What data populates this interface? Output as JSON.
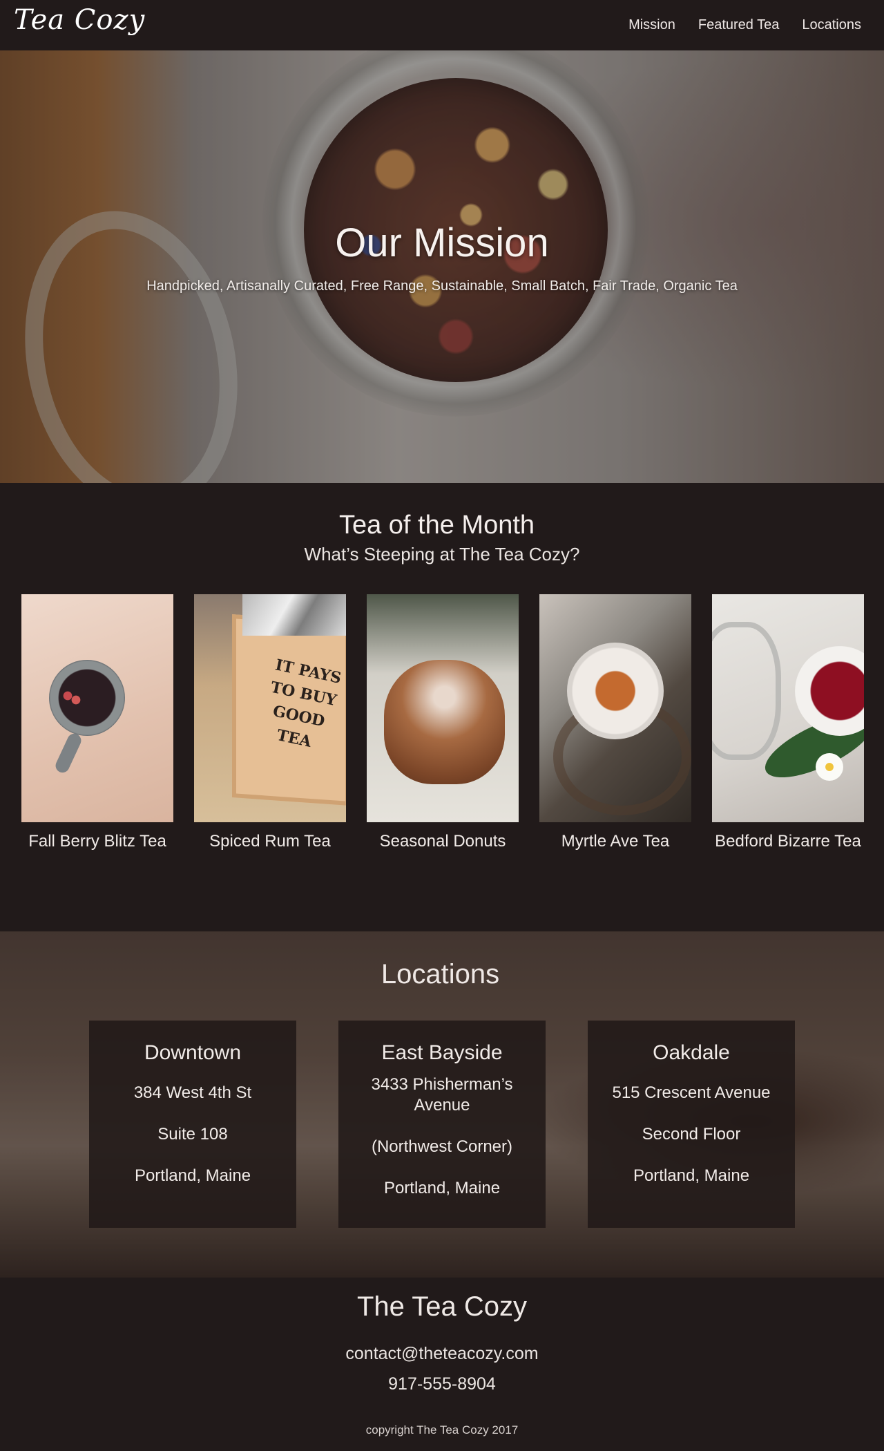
{
  "header": {
    "logo": "Tea Cozy",
    "nav": [
      "Mission",
      "Featured Tea",
      "Locations"
    ]
  },
  "hero": {
    "title": "Our Mission",
    "subtitle": "Handpicked, Artisanally Curated, Free Range, Sustainable, Small Batch, Fair Trade, Organic Tea"
  },
  "tea_of_month": {
    "title": "Tea of the Month",
    "subtitle": "What’s Steeping at The Tea Cozy?",
    "box_text": "IT PAYS TO BUY GOOD TEA",
    "items": [
      {
        "name": "Fall Berry Blitz Tea"
      },
      {
        "name": "Spiced Rum Tea"
      },
      {
        "name": "Seasonal Donuts"
      },
      {
        "name": "Myrtle Ave Tea"
      },
      {
        "name": "Bedford Bizarre Tea"
      }
    ]
  },
  "locations": {
    "title": "Locations",
    "cards": [
      {
        "name": "Downtown",
        "lines": [
          "384 West 4th St",
          "Suite 108",
          "Portland, Maine"
        ]
      },
      {
        "name": "East Bayside",
        "lines": [
          "3433 Phisherman’s Avenue",
          "(Northwest Corner)",
          "Portland, Maine"
        ]
      },
      {
        "name": "Oakdale",
        "lines": [
          "515 Crescent Avenue",
          "Second Floor",
          "Portland, Maine"
        ]
      }
    ]
  },
  "footer": {
    "title": "The Tea Cozy",
    "email": "contact@theteacozy.com",
    "phone": "917-555-8904",
    "copyright": "copyright The Tea Cozy 2017"
  },
  "colors": {
    "background": "#211a1a",
    "text": "#f2ecea",
    "card": "#211918"
  }
}
